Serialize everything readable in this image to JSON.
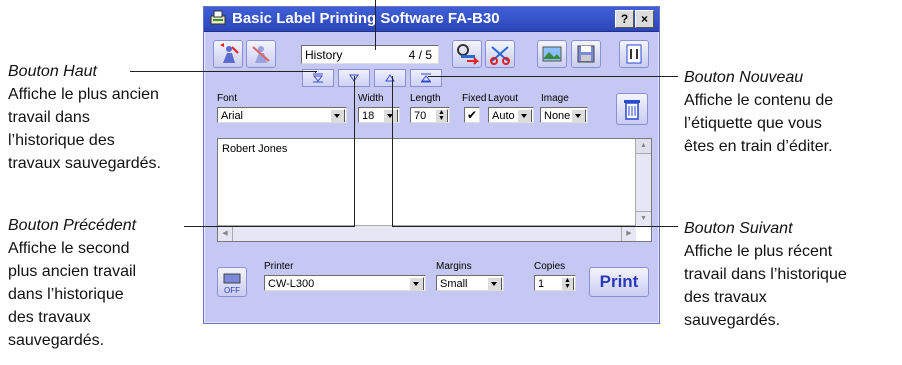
{
  "window": {
    "title": "Basic Label Printing Software FA-B30",
    "help_button": "?",
    "close_button": "×"
  },
  "history": {
    "label": "History",
    "counter": "4 / 5"
  },
  "fields": {
    "font_label": "Font",
    "font_value": "Arial",
    "width_label": "Width",
    "width_value": "18",
    "length_label": "Length",
    "length_value": "70",
    "fixed_label": "Fixed",
    "layout_label": "Layout",
    "layout_value": "Auto",
    "image_label": "Image",
    "image_value": "None"
  },
  "editor": {
    "text": "Robert Jones"
  },
  "bottom": {
    "printer_label": "Printer",
    "printer_value": "CW-L300",
    "margins_label": "Margins",
    "margins_value": "Small",
    "copies_label": "Copies",
    "copies_value": "1",
    "print_button": "Print",
    "off_label": "OFF"
  },
  "annotations": {
    "top": {
      "title": "Bouton Haut",
      "lines": [
        "Affiche le plus ancien",
        "travail dans",
        "l’historique des",
        "travaux sauvegardés."
      ]
    },
    "prev": {
      "title": "Bouton Précédent",
      "lines": [
        "Affiche le second",
        "plus ancien travail",
        "dans l’historique",
        "des travaux",
        "sauvegardés."
      ]
    },
    "new": {
      "title": "Bouton Nouveau",
      "lines": [
        "Affiche le contenu de",
        "l’étiquette que vous",
        "êtes en train d’éditer."
      ]
    },
    "next": {
      "title": "Bouton Suivant",
      "lines": [
        "Affiche le plus récent",
        "travail dans l’historique",
        "des travaux",
        "sauvegardés."
      ]
    }
  },
  "colors": {
    "window_bg": "#c4c8f2",
    "titlebar": "#3450c8",
    "print_text": "#2a3ab8"
  }
}
